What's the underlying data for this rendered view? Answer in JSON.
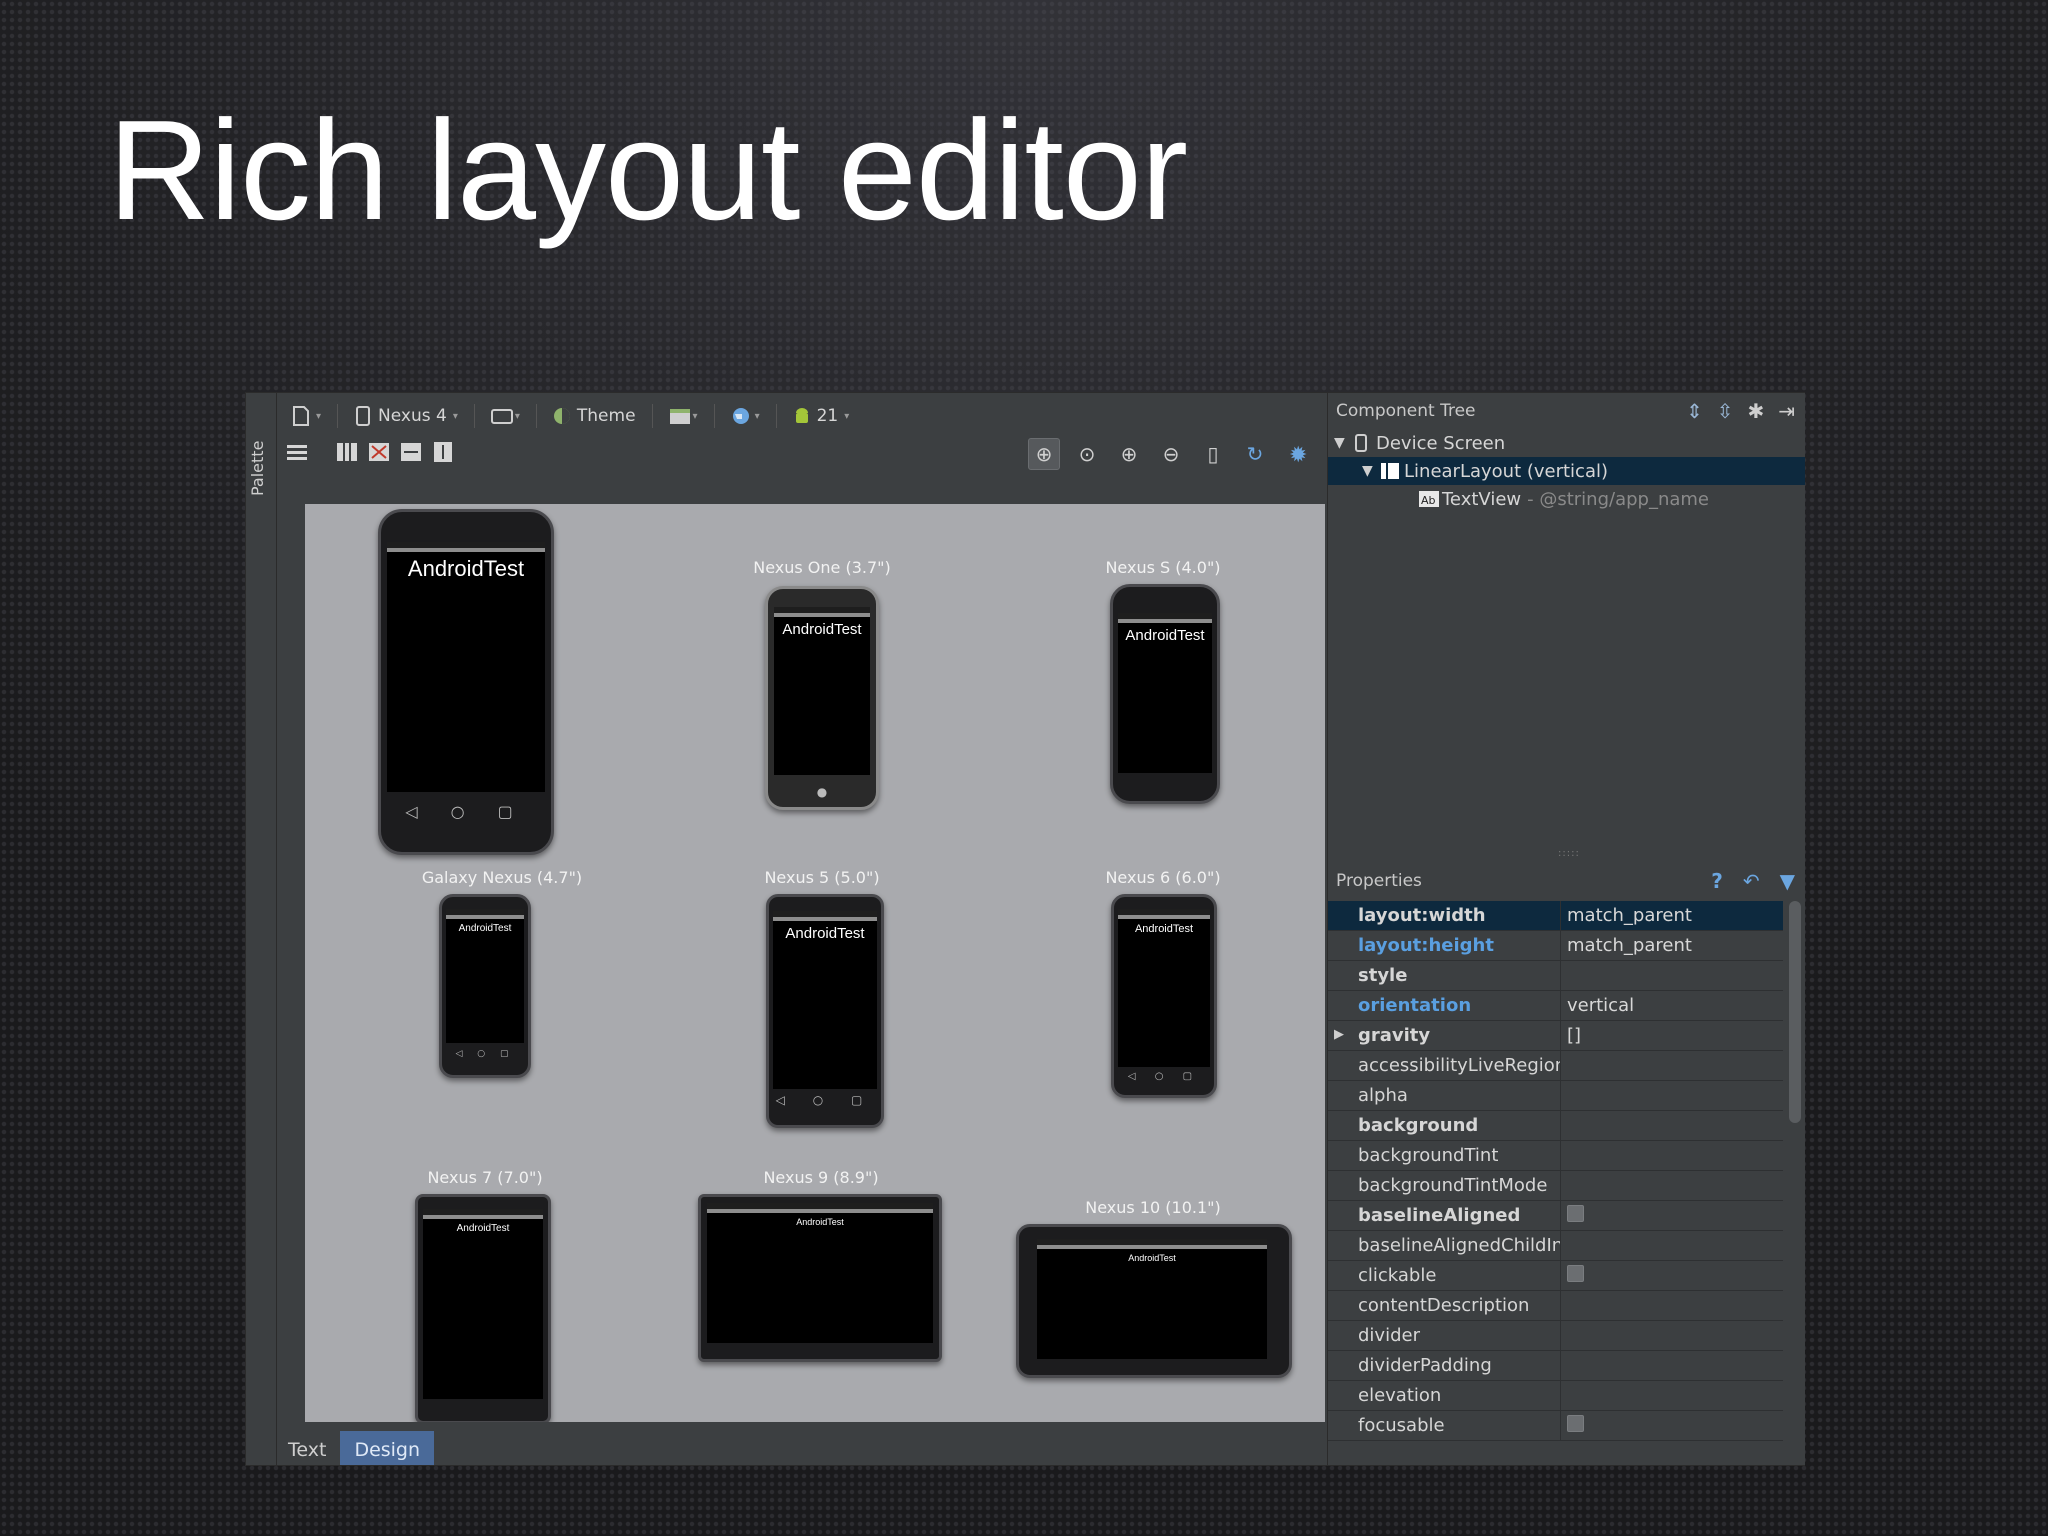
{
  "slide": {
    "title": "Rich layout editor"
  },
  "palette": {
    "label": "Palette"
  },
  "toolbar": {
    "device": "Nexus 4",
    "theme": "Theme",
    "api_level": "21"
  },
  "devices": [
    {
      "label": "",
      "title": "AndroidTest"
    },
    {
      "label": "Nexus One (3.7\")",
      "title": "AndroidTest"
    },
    {
      "label": "Nexus S (4.0\")",
      "title": "AndroidTest"
    },
    {
      "label": "Galaxy Nexus (4.7\")",
      "title": "AndroidTest"
    },
    {
      "label": "Nexus 5 (5.0\")",
      "title": "AndroidTest"
    },
    {
      "label": "Nexus 6 (6.0\")",
      "title": "AndroidTest"
    },
    {
      "label": "Nexus 7 (7.0\")",
      "title": "AndroidTest"
    },
    {
      "label": "Nexus 9 (8.9\")",
      "title": "AndroidTest"
    },
    {
      "label": "Nexus 10 (10.1\")",
      "title": "AndroidTest"
    }
  ],
  "editor_tabs": [
    "Text",
    "Design"
  ],
  "component_tree": {
    "title": "Component Tree",
    "nodes": [
      {
        "label": "Device Screen",
        "hint": ""
      },
      {
        "label": "LinearLayout (vertical)",
        "hint": ""
      },
      {
        "label": "TextView",
        "hint": "- @string/app_name"
      }
    ]
  },
  "properties": {
    "title": "Properties",
    "rows": [
      {
        "name": "layout:width",
        "value": "match_parent"
      },
      {
        "name": "layout:height",
        "value": "match_parent"
      },
      {
        "name": "style",
        "value": ""
      },
      {
        "name": "orientation",
        "value": "vertical"
      },
      {
        "name": "gravity",
        "value": "[]"
      },
      {
        "name": "accessibilityLiveRegion",
        "value": ""
      },
      {
        "name": "alpha",
        "value": ""
      },
      {
        "name": "background",
        "value": ""
      },
      {
        "name": "backgroundTint",
        "value": ""
      },
      {
        "name": "backgroundTintMode",
        "value": ""
      },
      {
        "name": "baselineAligned",
        "value": ""
      },
      {
        "name": "baselineAlignedChildIndex",
        "value": ""
      },
      {
        "name": "clickable",
        "value": ""
      },
      {
        "name": "contentDescription",
        "value": ""
      },
      {
        "name": "divider",
        "value": ""
      },
      {
        "name": "dividerPadding",
        "value": ""
      },
      {
        "name": "elevation",
        "value": ""
      },
      {
        "name": "focusable",
        "value": ""
      }
    ]
  },
  "colors": {
    "selection": "#0d293e",
    "accent_blue": "#5a9fe0",
    "canvas": "#a9aaae"
  }
}
